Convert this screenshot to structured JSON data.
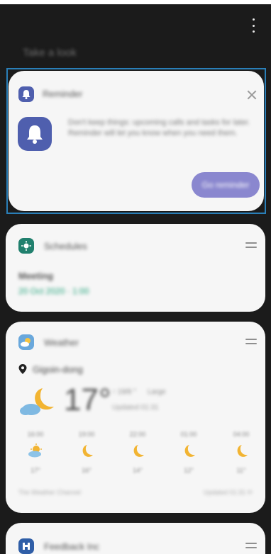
{
  "header": {
    "title": "Take a look"
  },
  "reminder": {
    "app_name": "Reminder",
    "body": "Don't keep things: upcoming calls and tasks for later. Reminder will let you know when you need them.",
    "cta_label": "Go reminder"
  },
  "schedule": {
    "app_name": "Schedules",
    "event_title": "Meeting",
    "event_time": "20 Oct 2020 · 1:00"
  },
  "weather": {
    "app_name": "Weather",
    "location": "Gigoin-dong",
    "temperature": "17°",
    "range": "↑ 19/8 °",
    "condition": "Large",
    "updated": "Updated 01:31",
    "forecast": [
      {
        "time": "16:00",
        "temp": "17°",
        "icon": "partly-sunny-icon"
      },
      {
        "time": "19:00",
        "temp": "16°",
        "icon": "moon-icon"
      },
      {
        "time": "22:00",
        "temp": "14°",
        "icon": "moon-icon"
      },
      {
        "time": "01:00",
        "temp": "12°",
        "icon": "moon-icon"
      },
      {
        "time": "04:00",
        "temp": "11°",
        "icon": "moon-icon"
      }
    ],
    "footer_left": "The Weather Channel",
    "footer_right": "Updated 01:31 ⟳"
  },
  "next_card": {
    "app_name": "Feedback Inc"
  },
  "colors": {
    "reminder_icon": "#4f5fae",
    "schedule_icon": "#21806e",
    "weather_icon": "#6aa8dc",
    "next_icon": "#2f5ea7",
    "moon": "#f2b432",
    "highlight": "#2a7fb8"
  }
}
